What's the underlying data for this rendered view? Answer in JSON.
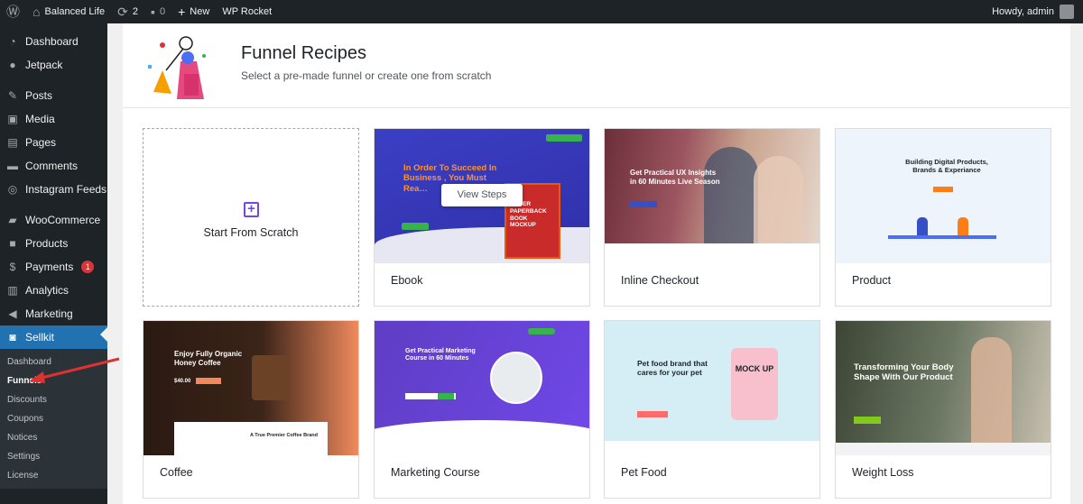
{
  "adminbar": {
    "site_name": "Balanced Life",
    "updates_count": "2",
    "comments_count": "0",
    "new_label": "New",
    "wp_rocket_label": "WP Rocket",
    "howdy": "Howdy, admin"
  },
  "sidebar": {
    "items": [
      {
        "label": "Dashboard",
        "icon": "dashboard-icon"
      },
      {
        "label": "Jetpack",
        "icon": "jetpack-icon"
      },
      {
        "label": "Posts",
        "icon": "pin-icon"
      },
      {
        "label": "Media",
        "icon": "media-icon"
      },
      {
        "label": "Pages",
        "icon": "pages-icon"
      },
      {
        "label": "Comments",
        "icon": "comment-icon"
      },
      {
        "label": "Instagram Feeds",
        "icon": "instagram-icon"
      },
      {
        "label": "WooCommerce",
        "icon": "woo-icon"
      },
      {
        "label": "Products",
        "icon": "box-icon"
      },
      {
        "label": "Payments",
        "icon": "dollar-icon",
        "badge": "1"
      },
      {
        "label": "Analytics",
        "icon": "chart-icon"
      },
      {
        "label": "Marketing",
        "icon": "megaphone-icon"
      },
      {
        "label": "Sellkit",
        "icon": "sellkit-icon"
      }
    ],
    "submenu": [
      "Dashboard",
      "Funnels",
      "Discounts",
      "Coupons",
      "Notices",
      "Settings",
      "License"
    ]
  },
  "header": {
    "title": "Funnel Recipes",
    "subtitle": "Select a pre-made funnel or create one from scratch"
  },
  "scratch": {
    "label": "Start From Scratch"
  },
  "view_steps": "View Steps",
  "cards": [
    {
      "label": "Ebook",
      "headline": "In Order To Succeed In Business , You Must Rea…",
      "book": "COVER PAPERBACK BOOK MOCKUP"
    },
    {
      "label": "Inline Checkout",
      "headline": "Get Practical UX Insights in 60 Minutes Live Season"
    },
    {
      "label": "Product",
      "headline": "Building Digital Products, Brands & Experiance"
    },
    {
      "label": "Coffee",
      "headline": "Enjoy Fully Organic Honey Coffee",
      "sub": "A True Premier Coffee Brand",
      "price": "$40.00"
    },
    {
      "label": "Marketing Course",
      "headline": "Get Practical Marketing Course in 60 Minutes"
    },
    {
      "label": "Pet Food",
      "headline": "Pet food brand that cares for your pet",
      "mock": "MOCK UP"
    },
    {
      "label": "Weight Loss",
      "headline": "Transforming Your Body Shape With Our Product"
    }
  ],
  "colors": {
    "accent": "#2271b1",
    "brand": "#7048e8",
    "adminbar": "#1d2327"
  }
}
